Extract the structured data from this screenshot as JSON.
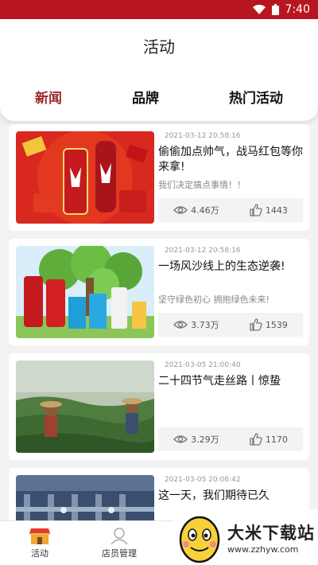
{
  "status_bar": {
    "time": "7:40"
  },
  "header": {
    "title": "活动"
  },
  "tabs": [
    {
      "label": "新闻",
      "active": true
    },
    {
      "label": "品牌",
      "active": false
    },
    {
      "label": "热门活动",
      "active": false
    }
  ],
  "articles": [
    {
      "date": "2021-03-12 20:58:16",
      "title": "偷偷加点帅气，战马红包等你来拿!",
      "subtitle": "我们决定搞点事情！！",
      "views": "4.46万",
      "likes": "1443",
      "thumb": "red-packet-cans"
    },
    {
      "date": "2021-03-12 20:58:16",
      "title": "一场风沙线上的生态逆袭!",
      "subtitle": "坚守绿色初心 拥抱绿色未来!",
      "views": "3.73万",
      "likes": "1539",
      "thumb": "green-tree-products"
    },
    {
      "date": "2021-03-05 21:00:40",
      "title": "二十四节气走丝路丨惊蛰",
      "subtitle": "",
      "views": "3.29万",
      "likes": "1170",
      "thumb": "tea-field"
    },
    {
      "date": "2021-03-05 20:06:42",
      "title": "这一天，我们期待已久",
      "subtitle": "",
      "views": "",
      "likes": "",
      "thumb": "factory"
    }
  ],
  "bottom_nav": [
    {
      "label": "活动",
      "icon": "shop-icon"
    },
    {
      "label": "店员管理",
      "icon": "staff-icon"
    },
    {
      "label": "",
      "icon": "scan-icon"
    }
  ],
  "watermark": {
    "name": "大米下载站",
    "url": "www.zzhyw.com"
  },
  "colors": {
    "status_bar": "#b8161f",
    "active_tab": "#9c2a2a"
  }
}
